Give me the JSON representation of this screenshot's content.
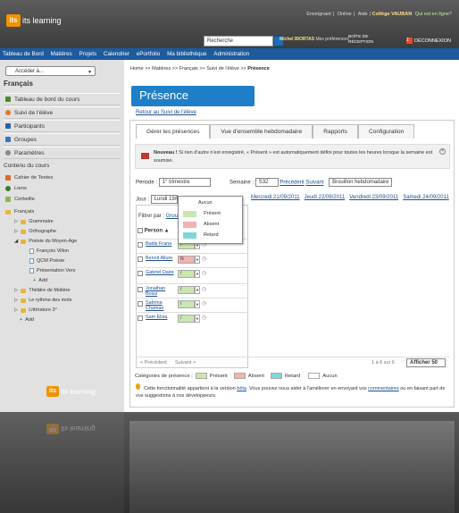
{
  "header": {
    "logo": "its learning",
    "links": [
      "Enseignant",
      "Online",
      "Aide"
    ],
    "school": "Collège VAUBAN",
    "help": "Qui est en ligne?",
    "search": "Recherche",
    "user": "Michel BIORTAS",
    "prefs": "Mes préférences",
    "mailbox": "BOÎTE DE RÉCEPTION",
    "mail_count": "1",
    "logout": "DÉCONNEXION"
  },
  "nav": [
    "Tableau de Bord",
    "Matières",
    "Projets",
    "Calendrier",
    "ePortfolio",
    "Ma bibliothèque",
    "Administration"
  ],
  "sidebar": {
    "select": "Accéder à...",
    "course": "Français",
    "items": [
      "Tableau de bord du cours",
      "Suivi de l'élève",
      "Participants",
      "Groupes",
      "Paramètres"
    ],
    "section": "Contenu du cours",
    "content": [
      "Cahier de Textes",
      "Liens",
      "Corbeille",
      "Français"
    ],
    "tree": [
      "Grammaire",
      "Orthographe",
      "Poésie du Moyen-Age",
      "François Villon",
      "QCM Poésie",
      "Présentation Vers",
      "Add",
      "Théâtre de Molière",
      "Le rythme des mots",
      "Littérature 3°",
      "Add"
    ]
  },
  "main": {
    "breadcrumb": "Home >> Matières >> Français >> Suivi de l'élève >>",
    "breadcrumb_current": "Présence",
    "title": "Présence",
    "back": "Retour au Suivi de l'élève",
    "tabs": [
      "Gérer les présences",
      "Vue d'ensemble hebdomadaire",
      "Rapports",
      "Configuration"
    ],
    "notice_bold": "Nouveau !",
    "notice": "Si rien d'autre n'est enregistré, « Présent » est automatiquement défini pour toutes les heures lorsque la semaine est soumise.",
    "periode_label": "Période :",
    "periode": "1° trimestre",
    "semaine_label": "Semaine :",
    "semaine": "S32",
    "prev": "Précédent",
    "next": "Suivant",
    "draft": "Brouillon hebdomadaire",
    "jour_label": "Jour :",
    "jour": "Lundi 19/0",
    "days": [
      "Mercredi 21/09/2011",
      "Jeudi 22/09/2011",
      "Vendredi 23/09/2011",
      "Samedi 24/09/2011"
    ],
    "filter_label": "Filtrer par :",
    "filter": "Grou",
    "col_person": "Person",
    "students": [
      "Badis Frana",
      "Benoit Allure",
      "Gabriel Daire",
      "Jonathan Bossi",
      "Sabrina Chaman",
      "Sam Elisa"
    ],
    "status": [
      "/",
      "N",
      "/",
      "/",
      "/",
      "/"
    ],
    "menu": [
      "Aucun",
      "Présent",
      "Absent",
      "Retard"
    ],
    "pager_prev": "< Précédent",
    "pager_next": "Suivant >",
    "pager_info": "1 à 6 sur 6",
    "pager_show": "Afficher 50",
    "legend_label": "Catégories de présence :",
    "legend": [
      "Présent",
      "Absent",
      "Retard",
      "Aucun"
    ],
    "beta_a": "Cette fonctionnalité appartient à la version ",
    "beta_link": "bêta",
    "beta_b": ". Vous pouvez nous aider à l'améliorer en envoyant vos ",
    "beta_link2": "commentaires",
    "beta_c": " ou en faisant part de vos suggestions à nos développeurs.",
    "reflect_logo": "its learning"
  },
  "colors": {
    "present": "#c8e6b0",
    "absent": "#f2b3b3",
    "retard": "#7fd7dc",
    "aucun": "#ffffff",
    "brand": "#1e7ec8",
    "nav": "#1d5b9f",
    "logo": "#f39200"
  }
}
